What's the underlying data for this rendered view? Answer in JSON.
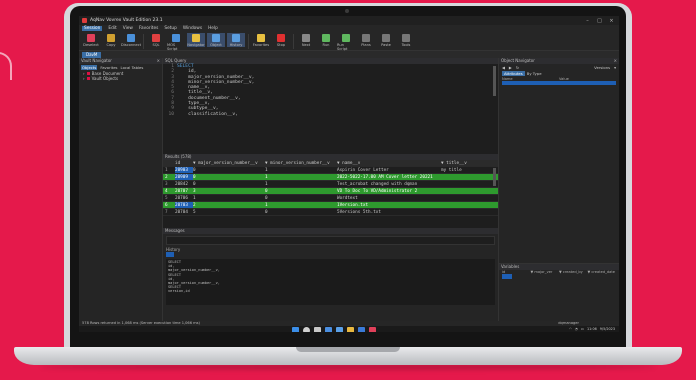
{
  "window": {
    "title": "AqNav Vovrex Vault Edition 23.1"
  },
  "menu": {
    "items": [
      "Session",
      "Edit",
      "View",
      "Favorites",
      "Setup",
      "Windows",
      "Help"
    ]
  },
  "toolbar": {
    "buttons": [
      {
        "label": "Deselect",
        "color": "#e0405a"
      },
      {
        "label": "Copy",
        "color": "#d0a030"
      },
      {
        "label": "Disconnect",
        "color": "#4a90d9"
      },
      {
        "label": "SQL",
        "color": "#e04040"
      },
      {
        "label": "MOS Script",
        "color": "#4a90d9"
      },
      {
        "label": "Navigator",
        "color": "#e8c040"
      },
      {
        "label": "Object",
        "color": "#5a9ee0"
      },
      {
        "label": "History",
        "color": "#5a9ee0"
      },
      {
        "label": "Favorites",
        "color": "#e8c040"
      },
      {
        "label": "Stop",
        "color": "#e03030"
      },
      {
        "label": "Next",
        "color": "#888888"
      },
      {
        "label": "Run",
        "color": "#5fb85f"
      },
      {
        "label": "Run Script",
        "color": "#5fb85f"
      },
      {
        "label": "Plans",
        "color": "#777777"
      },
      {
        "label": "Paste",
        "color": "#777777"
      },
      {
        "label": "Tools",
        "color": "#777777"
      }
    ]
  },
  "doc_tab": {
    "label": "DavM"
  },
  "vault_nav": {
    "title": "Vault Navigator",
    "tabs": [
      "Objects",
      "Favorites",
      "Local Tables"
    ],
    "items": [
      "Base Document",
      "Vault Objects"
    ]
  },
  "query": {
    "title": "SQL Query",
    "lines": [
      {
        "n": "1",
        "code": "SELECT"
      },
      {
        "n": "2",
        "code": "    id,"
      },
      {
        "n": "3",
        "code": "    major_version_number__v,"
      },
      {
        "n": "4",
        "code": "    minor_version_number__v,"
      },
      {
        "n": "5",
        "code": "    name__v,"
      },
      {
        "n": "6",
        "code": "    title__v,"
      },
      {
        "n": "7",
        "code": "    document_number__v,"
      },
      {
        "n": "8",
        "code": "    type__v,"
      },
      {
        "n": "9",
        "code": "    subtype__v,"
      },
      {
        "n": "10",
        "code": "    classification__v,"
      }
    ]
  },
  "results": {
    "title": "Results (578)",
    "headers": [
      "id",
      "▼ major_version_number__v",
      "▼ minor_version_number__v",
      "▼ name__v",
      "▼ title__v"
    ],
    "rows": [
      {
        "n": "1",
        "id": "20903",
        "major": "0",
        "minor": "1",
        "name": "Aspirin Cover Letter",
        "title": "my title",
        "hl": false
      },
      {
        "n": "2",
        "id": "20909",
        "major": "0",
        "minor": "1",
        "name": "2022-5022-17.00 AM Cover letter 20221",
        "title": "",
        "hl": true
      },
      {
        "n": "3",
        "id": "20842",
        "major": "0",
        "minor": "1",
        "name": "Test_acrobat changed with dqman",
        "title": "",
        "hl": false
      },
      {
        "n": "4",
        "id": "20707",
        "major": "3",
        "minor": "0",
        "name": "VD To Doc To VD/Administrator 2",
        "title": "",
        "hl": true
      },
      {
        "n": "5",
        "id": "20706",
        "major": "1",
        "minor": "0",
        "name": "Wordtext",
        "title": "",
        "hl": false
      },
      {
        "n": "6",
        "id": "20703",
        "major": "2",
        "minor": "1",
        "name": "1Version.txt",
        "title": "",
        "hl": true
      },
      {
        "n": "7",
        "id": "20704",
        "major": "5",
        "minor": "0",
        "name": "5Versions 5th.txt",
        "title": "",
        "hl": false
      }
    ]
  },
  "messages": {
    "title": "Messages",
    "history_label": "History",
    "history_lines": [
      "SELECT",
      "  id,",
      "  major_version_number__v,",
      "SELECT",
      "  id,",
      "  major_version_number__v,",
      "SELECT",
      "  version,id"
    ]
  },
  "object_nav": {
    "title": "Object Navigator",
    "dropdown": "Versions",
    "tabs": [
      "Attributes",
      "By Type"
    ],
    "cols": [
      "Name",
      "Value"
    ]
  },
  "variables": {
    "title": "Variables",
    "cols": [
      "id",
      "▼ major_ver",
      "▼ created_by",
      "▼ created_date"
    ]
  },
  "status": {
    "left": "578 Rows returned in 1,068 ms (Server execution time 1,066 ms)",
    "right": "dqmanager"
  },
  "tray": {
    "time": "11:06",
    "date": "9/5/2023"
  }
}
